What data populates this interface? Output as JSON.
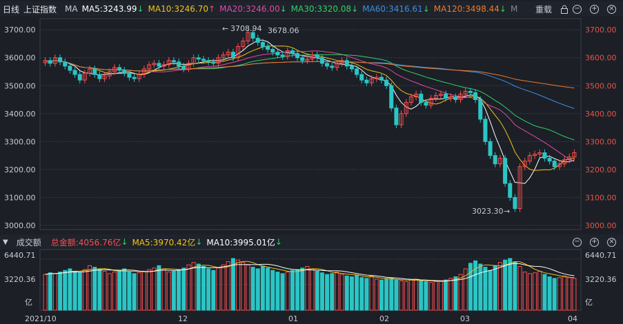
{
  "topbar": {
    "period": "日线",
    "index_name": "上证指数",
    "ma_label": "MA",
    "ma5": "MA5:3243.99",
    "ma10": "MA10:3246.70",
    "ma20": "MA20:3246.00",
    "ma30": "MA30:3320.08",
    "ma60": "MA60:3416.61",
    "ma120": "MA120:3498.44",
    "ma_more": "M",
    "restore_label": "重载",
    "up_arrow": "↑",
    "down_arrow": "↓"
  },
  "colors": {
    "ma5": "#ffffff",
    "ma10": "#f0c419",
    "ma20": "#e04aa8",
    "ma30": "#2fd26b",
    "ma60": "#3c8fe6",
    "ma120": "#f07a2a",
    "ma250": "#b8b8c8",
    "up": "#ff4d4f",
    "down": "#2bc5c5",
    "grid": "#3a3f4a"
  },
  "price_axis": {
    "ticks": [
      "3700.00",
      "3600.00",
      "3500.00",
      "3400.00",
      "3300.00",
      "3200.00",
      "3100.00",
      "3000.00"
    ],
    "range": [
      2985,
      3740
    ]
  },
  "annotations": {
    "high": "3708.94",
    "high2": "3678.06",
    "low": "3023.30"
  },
  "volbar": {
    "label": "成交额",
    "total": "总金额:4056.76亿",
    "ma5": "MA5:3970.42亿",
    "ma10": "MA10:3995.01亿"
  },
  "vol_axis": {
    "ticks": [
      "6440.71",
      "3220.36",
      "亿"
    ],
    "range": [
      0,
      7100
    ]
  },
  "x_axis": {
    "labels": [
      "2021/10",
      "12",
      "01",
      "02",
      "03",
      "04"
    ]
  },
  "chart_data": {
    "type": "candlestick",
    "series_closes": [
      3590,
      3580,
      3600,
      3585,
      3570,
      3555,
      3540,
      3520,
      3545,
      3560,
      3540,
      3525,
      3535,
      3550,
      3565,
      3555,
      3545,
      3530,
      3525,
      3540,
      3560,
      3575,
      3580,
      3570,
      3575,
      3590,
      3585,
      3570,
      3560,
      3580,
      3600,
      3595,
      3590,
      3585,
      3580,
      3600,
      3610,
      3620,
      3600,
      3640,
      3660,
      3690,
      3670,
      3655,
      3640,
      3630,
      3620,
      3610,
      3605,
      3625,
      3615,
      3600,
      3590,
      3595,
      3610,
      3600,
      3580,
      3570,
      3565,
      3580,
      3590,
      3570,
      3560,
      3540,
      3520,
      3510,
      3525,
      3530,
      3520,
      3500,
      3420,
      3360,
      3400,
      3440,
      3460,
      3470,
      3440,
      3430,
      3455,
      3465,
      3470,
      3455,
      3460,
      3450,
      3470,
      3480,
      3475,
      3450,
      3380,
      3300,
      3250,
      3220,
      3240,
      3150,
      3100,
      3060,
      3210,
      3230,
      3250,
      3255,
      3260,
      3240,
      3230,
      3210,
      3220,
      3235,
      3245,
      3260
    ],
    "volumes": [
      4500,
      4700,
      4600,
      4800,
      5000,
      5200,
      4900,
      4700,
      5100,
      5600,
      5400,
      5200,
      4900,
      4600,
      4800,
      5000,
      5200,
      4800,
      4600,
      4700,
      4900,
      5100,
      5300,
      5600,
      5200,
      4800,
      4900,
      5100,
      5300,
      5700,
      6000,
      5800,
      5500,
      5200,
      5000,
      5300,
      5700,
      6100,
      6500,
      6300,
      6000,
      5700,
      5400,
      5200,
      5500,
      5300,
      5000,
      4800,
      4600,
      4800,
      5000,
      5100,
      5300,
      5500,
      5200,
      4900,
      4700,
      4500,
      4600,
      4800,
      4500,
      4300,
      4200,
      4400,
      4100,
      4000,
      4300,
      3900,
      3800,
      3900,
      4000,
      3800,
      3700,
      3600,
      3800,
      3900,
      3700,
      3600,
      3500,
      3600,
      3700,
      3800,
      4000,
      4200,
      4500,
      5200,
      5900,
      6200,
      5800,
      5400,
      5000,
      5600,
      6000,
      6300,
      6500,
      6100,
      5500,
      4800,
      4600,
      4700,
      4900,
      4500,
      4200,
      4000,
      4100,
      4300,
      4100,
      4000
    ]
  }
}
